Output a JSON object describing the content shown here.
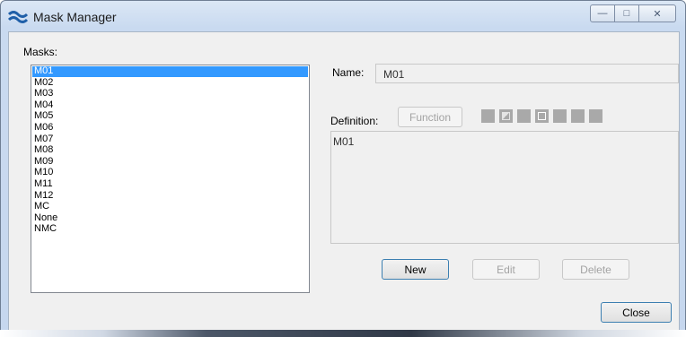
{
  "window": {
    "title": "Mask Manager",
    "caption_buttons": {
      "minimize": "—",
      "maximize": "□",
      "close": "✕"
    }
  },
  "masks": {
    "label": "Masks:",
    "selected": "M01",
    "items": [
      "M01",
      "M02",
      "M03",
      "M04",
      "M05",
      "M06",
      "M07",
      "M08",
      "M09",
      "M10",
      "M11",
      "M12",
      "MC",
      "None",
      "NMC"
    ]
  },
  "name": {
    "label": "Name:",
    "value": "M01"
  },
  "definition": {
    "label": "Definition:",
    "function_button": "Function",
    "value": "M01",
    "swatches": [
      "solid",
      "grid",
      "solid",
      "hollow",
      "solid",
      "solid",
      "solid"
    ]
  },
  "buttons": {
    "new": "New",
    "edit": "Edit",
    "delete": "Delete",
    "close": "Close"
  },
  "colors": {
    "selection": "#3399ff",
    "swatch": "#a9a9a9"
  }
}
